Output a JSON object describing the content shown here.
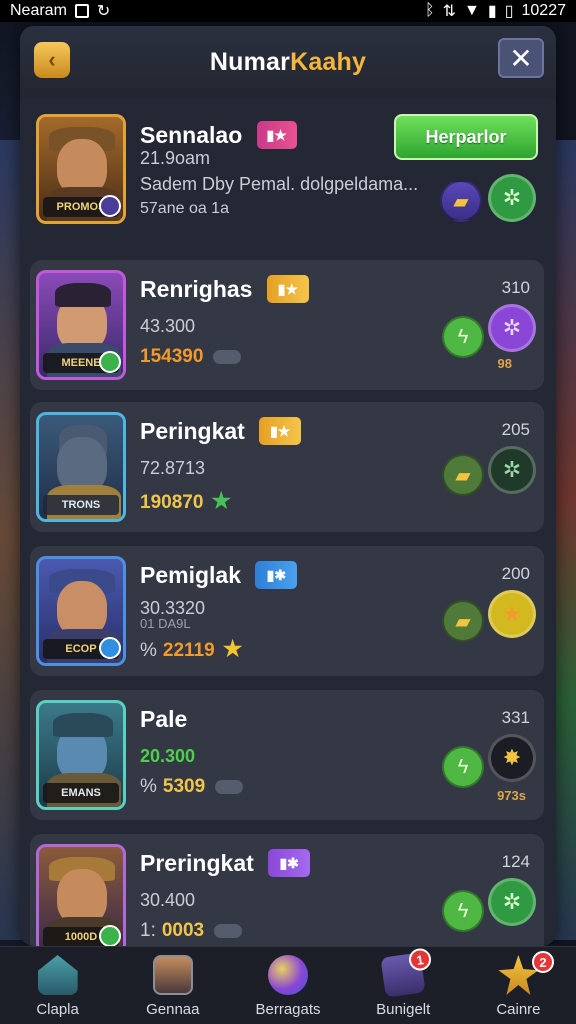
{
  "status_bar": {
    "carrier": "Nearam",
    "time": "10227"
  },
  "header": {
    "title_part1": "Numar",
    "title_part2": "Kaahy",
    "close_label": "✕",
    "back_label": "‹"
  },
  "top_entry": {
    "name": "Sennalao",
    "stat": "21.9oam",
    "description": "Sadem Dby Pemal. dolgpeldama...",
    "meta": "57ane oa 1a",
    "avatar_plate": "PROMOS",
    "action_label": "Herparlor"
  },
  "entries": [
    {
      "name": "Renrighas",
      "stat": "43.300",
      "score_prefix": "",
      "score": "154390",
      "right_num": "310",
      "note": "98",
      "plate": "MEENE",
      "badge_color": "#3bb34a"
    },
    {
      "name": "Peringkat",
      "stat": "72.8713",
      "score_prefix": "",
      "score": "190870",
      "right_num": "205",
      "note": "",
      "plate": "TRONS",
      "badge_color": ""
    },
    {
      "name": "Pemiglak",
      "stat": "30.3320",
      "substat": "01 DA9L",
      "score_prefix": "%",
      "score": "22119",
      "right_num": "200",
      "note": "",
      "plate": "ECOP",
      "badge_color": "#2f8fe0"
    },
    {
      "name": "Pale",
      "stat": "20.300",
      "score_prefix": "%",
      "score": "5309",
      "right_num": "331",
      "note": "973s",
      "plate": "EMANS",
      "badge_color": ""
    },
    {
      "name": "Preringkat",
      "stat": "30.400",
      "score_prefix": "1:",
      "score": "0003",
      "right_num": "124",
      "note": "",
      "plate": "1000D",
      "badge_color": "#3bb34a"
    }
  ],
  "nav": [
    {
      "label": "Clapla",
      "icon": "home-icon",
      "badge": ""
    },
    {
      "label": "Gennaa",
      "icon": "profile-icon",
      "badge": ""
    },
    {
      "label": "Berragats",
      "icon": "orbs-icon",
      "badge": ""
    },
    {
      "label": "Bunigelt",
      "icon": "scroll-icon",
      "badge": "1"
    },
    {
      "label": "Cainre",
      "icon": "star-burst-icon",
      "badge": "2"
    }
  ],
  "colors": {
    "accent_gold": "#f4b63b",
    "accent_green": "#3fba3c",
    "panel_bg": "#242834"
  }
}
